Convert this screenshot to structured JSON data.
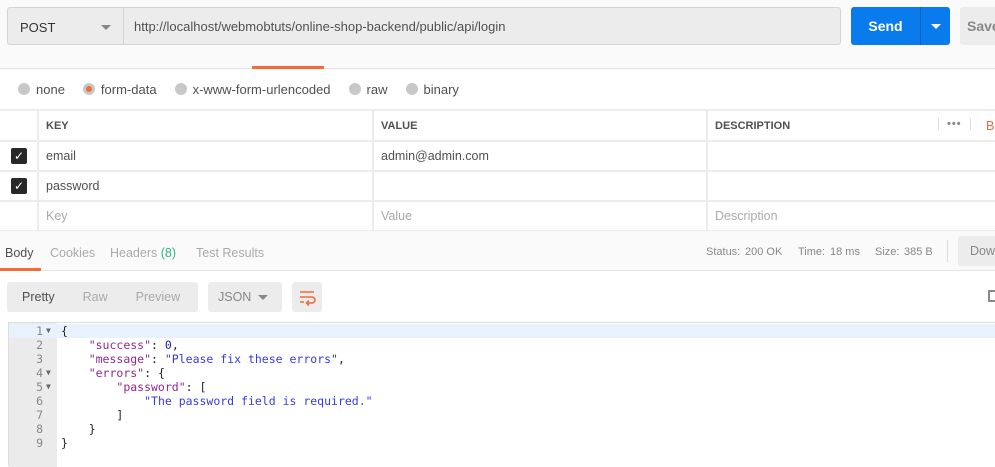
{
  "request": {
    "method": "POST",
    "url": "http://localhost/webmobtuts/online-shop-backend/public/api/login",
    "send_label": "Send",
    "save_label": "Save"
  },
  "body_types": [
    {
      "label": "none",
      "selected": false
    },
    {
      "label": "form-data",
      "selected": true
    },
    {
      "label": "x-www-form-urlencoded",
      "selected": false
    },
    {
      "label": "raw",
      "selected": false
    },
    {
      "label": "binary",
      "selected": false
    }
  ],
  "table": {
    "headers": {
      "key": "KEY",
      "value": "VALUE",
      "description": "DESCRIPTION",
      "more": "•••",
      "bulk": "Bulk Edit"
    },
    "rows": [
      {
        "checked": true,
        "key": "email",
        "value": "admin@admin.com",
        "description": ""
      },
      {
        "checked": true,
        "key": "password",
        "value": "",
        "description": ""
      }
    ],
    "placeholders": {
      "key": "Key",
      "value": "Value",
      "description": "Description"
    }
  },
  "response": {
    "tabs": [
      {
        "label": "Body"
      },
      {
        "label": "Cookies"
      },
      {
        "label": "Headers",
        "count": "(8)"
      },
      {
        "label": "Test Results"
      }
    ],
    "status_label": "Status:",
    "status": "200 OK",
    "time_label": "Time:",
    "time": "18 ms",
    "size_label": "Size:",
    "size": "385 B",
    "download_label": "Download",
    "views": [
      "Pretty",
      "Raw",
      "Preview"
    ],
    "format": "JSON"
  },
  "colors": {
    "accent": "#f26b3a",
    "send": "#097bed",
    "success": "#2eb67d"
  }
}
